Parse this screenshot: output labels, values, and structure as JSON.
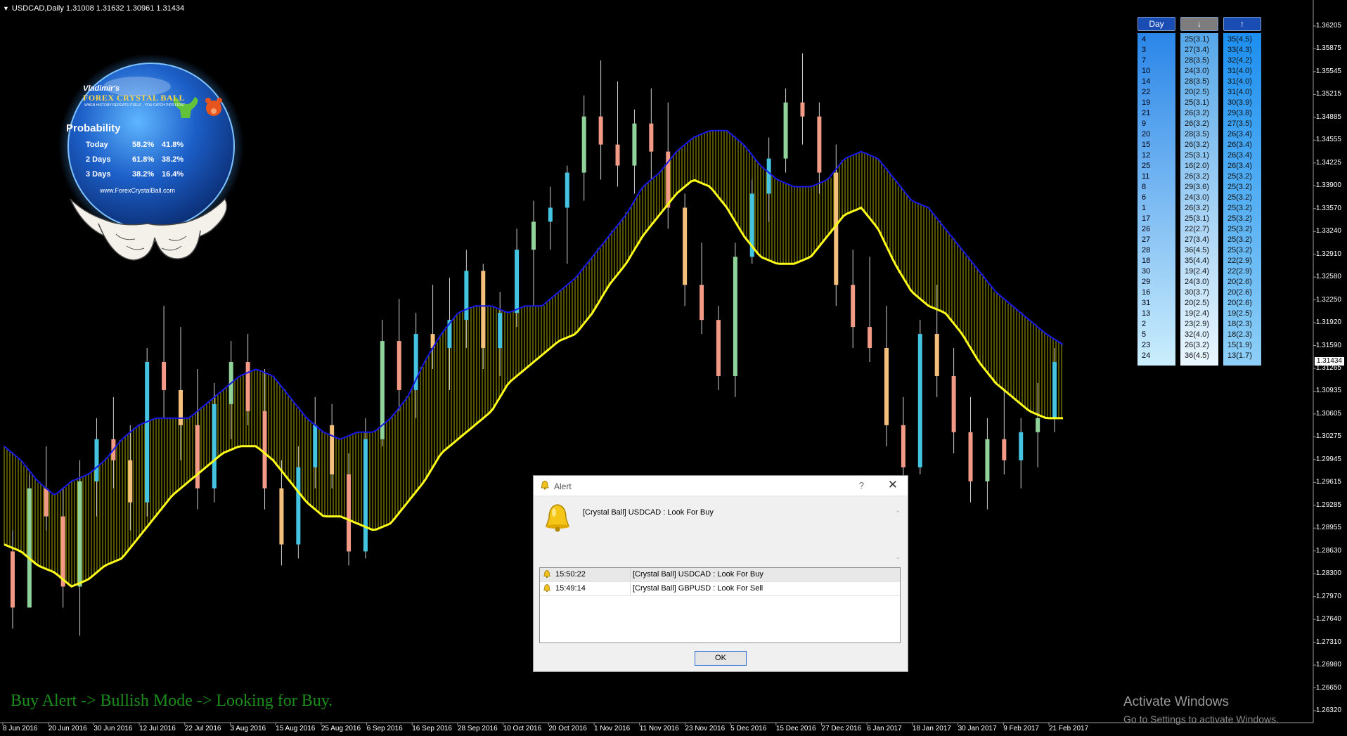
{
  "chart": {
    "header": "USDCAD,Daily  1.31008 1.31632 1.30961 1.31434",
    "current_price": "1.31434",
    "price_axis": [
      "1.36205",
      "1.35875",
      "1.35545",
      "1.35215",
      "1.34885",
      "1.34555",
      "1.34225",
      "1.33900",
      "1.33570",
      "1.33240",
      "1.32910",
      "1.32580",
      "1.32250",
      "1.31920",
      "1.31590",
      "1.31265",
      "1.30935",
      "1.30605",
      "1.30275",
      "1.29945",
      "1.29615",
      "1.29285",
      "1.28955",
      "1.28630",
      "1.28300",
      "1.27970",
      "1.27640",
      "1.27310",
      "1.26980",
      "1.26650",
      "1.26320"
    ],
    "date_axis": [
      "8 Jun 2016",
      "20 Jun 2016",
      "30 Jun 2016",
      "12 Jul 2016",
      "22 Jul 2016",
      "3 Aug 2016",
      "15 Aug 2016",
      "25 Aug 2016",
      "6 Sep 2016",
      "16 Sep 2016",
      "28 Sep 2016",
      "10 Oct 2016",
      "20 Oct 2016",
      "1 Nov 2016",
      "11 Nov 2016",
      "23 Nov 2016",
      "5 Dec 2016",
      "15 Dec 2016",
      "27 Dec 2016",
      "6 Jan 2017",
      "18 Jan 2017",
      "30 Jan 2017",
      "9 Feb 2017",
      "21 Feb 2017"
    ],
    "colors": {
      "bull": "#44c4e0",
      "bull_light": "#8fd39a",
      "bear": "#f29a86",
      "bear_light": "#f4c07c",
      "upper_band": "#1818e8",
      "lower_band": "#ffff1a",
      "fill": "#c8c800"
    }
  },
  "chart_data": {
    "type": "candlestick",
    "symbol": "USDCAD",
    "timeframe": "Daily",
    "ylim": [
      1.2632,
      1.3638
    ],
    "upper_band": [
      1.302,
      1.3,
      1.297,
      1.295,
      1.297,
      1.298,
      1.3,
      1.303,
      1.305,
      1.306,
      1.306,
      1.306,
      1.308,
      1.31,
      1.312,
      1.313,
      1.312,
      1.309,
      1.306,
      1.304,
      1.303,
      1.304,
      1.304,
      1.306,
      1.309,
      1.314,
      1.318,
      1.321,
      1.322,
      1.322,
      1.321,
      1.322,
      1.322,
      1.324,
      1.326,
      1.329,
      1.332,
      1.335,
      1.339,
      1.341,
      1.344,
      1.346,
      1.347,
      1.347,
      1.345,
      1.342,
      1.34,
      1.339,
      1.339,
      1.34,
      1.343,
      1.344,
      1.343,
      1.34,
      1.337,
      1.336,
      1.333,
      1.33,
      1.327,
      1.324,
      1.322,
      1.32,
      1.318,
      1.3165
    ],
    "lower_band": [
      1.288,
      1.287,
      1.285,
      1.284,
      1.282,
      1.283,
      1.285,
      1.286,
      1.289,
      1.292,
      1.295,
      1.297,
      1.299,
      1.301,
      1.302,
      1.302,
      1.3,
      1.297,
      1.294,
      1.292,
      1.292,
      1.291,
      1.29,
      1.291,
      1.294,
      1.297,
      1.301,
      1.303,
      1.305,
      1.307,
      1.311,
      1.313,
      1.315,
      1.317,
      1.318,
      1.321,
      1.325,
      1.328,
      1.332,
      1.335,
      1.338,
      1.34,
      1.339,
      1.336,
      1.332,
      1.329,
      1.328,
      1.328,
      1.329,
      1.332,
      1.335,
      1.336,
      1.333,
      1.328,
      1.324,
      1.322,
      1.321,
      1.318,
      1.314,
      1.311,
      1.309,
      1.307,
      1.306,
      1.306
    ],
    "candles_approx": [
      [
        1.287,
        1.29,
        1.276,
        1.279
      ],
      [
        1.279,
        1.298,
        1.279,
        1.296
      ],
      [
        1.296,
        1.302,
        1.29,
        1.292
      ],
      [
        1.292,
        1.296,
        1.279,
        1.282
      ],
      [
        1.282,
        1.3,
        1.275,
        1.297
      ],
      [
        1.297,
        1.306,
        1.292,
        1.303
      ],
      [
        1.303,
        1.309,
        1.296,
        1.3
      ],
      [
        1.3,
        1.305,
        1.29,
        1.294
      ],
      [
        1.294,
        1.316,
        1.292,
        1.314
      ],
      [
        1.314,
        1.322,
        1.306,
        1.31
      ],
      [
        1.31,
        1.319,
        1.3,
        1.305
      ],
      [
        1.305,
        1.313,
        1.293,
        1.296
      ],
      [
        1.296,
        1.311,
        1.294,
        1.308
      ],
      [
        1.308,
        1.317,
        1.303,
        1.314
      ],
      [
        1.314,
        1.318,
        1.305,
        1.307
      ],
      [
        1.307,
        1.313,
        1.293,
        1.296
      ],
      [
        1.296,
        1.3,
        1.285,
        1.288
      ],
      [
        1.288,
        1.302,
        1.286,
        1.299
      ],
      [
        1.299,
        1.309,
        1.296,
        1.305
      ],
      [
        1.305,
        1.308,
        1.296,
        1.298
      ],
      [
        1.298,
        1.301,
        1.285,
        1.287
      ],
      [
        1.287,
        1.306,
        1.286,
        1.303
      ],
      [
        1.303,
        1.32,
        1.302,
        1.317
      ],
      [
        1.317,
        1.323,
        1.307,
        1.31
      ],
      [
        1.31,
        1.321,
        1.306,
        1.318
      ],
      [
        1.318,
        1.325,
        1.313,
        1.316
      ],
      [
        1.316,
        1.326,
        1.31,
        1.32
      ],
      [
        1.32,
        1.33,
        1.316,
        1.327
      ],
      [
        1.327,
        1.328,
        1.313,
        1.316
      ],
      [
        1.316,
        1.324,
        1.312,
        1.321
      ],
      [
        1.321,
        1.333,
        1.319,
        1.33
      ],
      [
        1.33,
        1.337,
        1.322,
        1.334
      ],
      [
        1.334,
        1.339,
        1.33,
        1.336
      ],
      [
        1.336,
        1.342,
        1.328,
        1.341
      ],
      [
        1.341,
        1.352,
        1.337,
        1.349
      ],
      [
        1.349,
        1.357,
        1.34,
        1.345
      ],
      [
        1.345,
        1.354,
        1.339,
        1.342
      ],
      [
        1.342,
        1.35,
        1.338,
        1.348
      ],
      [
        1.348,
        1.353,
        1.34,
        1.344
      ],
      [
        1.344,
        1.351,
        1.333,
        1.336
      ],
      [
        1.336,
        1.338,
        1.322,
        1.325
      ],
      [
        1.325,
        1.331,
        1.318,
        1.32
      ],
      [
        1.32,
        1.322,
        1.31,
        1.312
      ],
      [
        1.312,
        1.331,
        1.309,
        1.329
      ],
      [
        1.329,
        1.34,
        1.328,
        1.338
      ],
      [
        1.338,
        1.346,
        1.334,
        1.343
      ],
      [
        1.343,
        1.353,
        1.341,
        1.351
      ],
      [
        1.351,
        1.358,
        1.345,
        1.349
      ],
      [
        1.349,
        1.351,
        1.338,
        1.341
      ],
      [
        1.341,
        1.345,
        1.322,
        1.325
      ],
      [
        1.325,
        1.33,
        1.316,
        1.319
      ],
      [
        1.319,
        1.329,
        1.314,
        1.316
      ],
      [
        1.316,
        1.322,
        1.302,
        1.305
      ],
      [
        1.305,
        1.309,
        1.296,
        1.299
      ],
      [
        1.299,
        1.32,
        1.298,
        1.318
      ],
      [
        1.318,
        1.325,
        1.309,
        1.312
      ],
      [
        1.312,
        1.316,
        1.301,
        1.304
      ],
      [
        1.304,
        1.309,
        1.294,
        1.297
      ],
      [
        1.297,
        1.306,
        1.293,
        1.303
      ],
      [
        1.303,
        1.31,
        1.298,
        1.3
      ],
      [
        1.3,
        1.306,
        1.296,
        1.304
      ],
      [
        1.304,
        1.311,
        1.299,
        1.306
      ],
      [
        1.306,
        1.316,
        1.304,
        1.314
      ]
    ]
  },
  "logo": {
    "brand_small": "Vladimir's",
    "brand_big": "FOREX CRYSTAL BALL",
    "tagline": "WHEN HISTORY REPEATS ITSELF · YOU CATCH PIPS FIRST",
    "heading": "Probability",
    "rows": [
      {
        "label": "Today",
        "bull": "58.2%",
        "bear": "41.8%"
      },
      {
        "label": "2 Days",
        "bull": "61.8%",
        "bear": "38.2%"
      },
      {
        "label": "3 Days",
        "bull": "38.2%",
        "bear": "16.4%"
      }
    ],
    "url": "www.ForexCrystalBall.com"
  },
  "prob_table": {
    "headers": {
      "day": "Day",
      "down": "↓",
      "up": "↑"
    },
    "days": [
      "4",
      "3",
      "7",
      "10",
      "14",
      "22",
      "19",
      "21",
      "9",
      "20",
      "15",
      "12",
      "25",
      "11",
      "8",
      "6",
      "1",
      "17",
      "26",
      "27",
      "28",
      "18",
      "30",
      "29",
      "16",
      "31",
      "13",
      "2",
      "5",
      "23",
      "24"
    ],
    "down": [
      "25(3.1)",
      "27(3.4)",
      "28(3.5)",
      "24(3.0)",
      "28(3.5)",
      "20(2.5)",
      "25(3.1)",
      "26(3.2)",
      "26(3.2)",
      "28(3.5)",
      "26(3.2)",
      "25(3.1)",
      "16(2.0)",
      "26(3.2)",
      "29(3.6)",
      "24(3.0)",
      "26(3.2)",
      "25(3.1)",
      "22(2.7)",
      "27(3.4)",
      "36(4.5)",
      "35(4.4)",
      "19(2.4)",
      "24(3.0)",
      "30(3.7)",
      "20(2.5)",
      "19(2.4)",
      "23(2.9)",
      "32(4.0)",
      "26(3.2)",
      "36(4.5)"
    ],
    "up": [
      "35(4.5)",
      "33(4.3)",
      "32(4.2)",
      "31(4.0)",
      "31(4.0)",
      "31(4.0)",
      "30(3.9)",
      "29(3.8)",
      "27(3.5)",
      "26(3.4)",
      "26(3.4)",
      "26(3.4)",
      "26(3.4)",
      "25(3.2)",
      "25(3.2)",
      "25(3.2)",
      "25(3.2)",
      "25(3.2)",
      "25(3.2)",
      "25(3.2)",
      "25(3.2)",
      "22(2.9)",
      "22(2.9)",
      "20(2.6)",
      "20(2.6)",
      "20(2.6)",
      "19(2.5)",
      "18(2.3)",
      "18(2.3)",
      "15(1.9)",
      "13(1.7)"
    ]
  },
  "bottom_text": "Buy Alert -> Bullish Mode -> Looking for Buy.",
  "watermark": {
    "line1": "Activate Windows",
    "line2": "Go to Settings to activate Windows."
  },
  "alert": {
    "title": "Alert",
    "help": "?",
    "close": "✕",
    "message": "[Crystal Ball] USDCAD : Look For Buy",
    "rows": [
      {
        "time": "15:50:22",
        "msg": "[Crystal Ball] USDCAD : Look For Buy"
      },
      {
        "time": "15:49:14",
        "msg": "[Crystal Ball] GBPUSD : Look For Sell"
      }
    ],
    "ok_label": "OK"
  }
}
